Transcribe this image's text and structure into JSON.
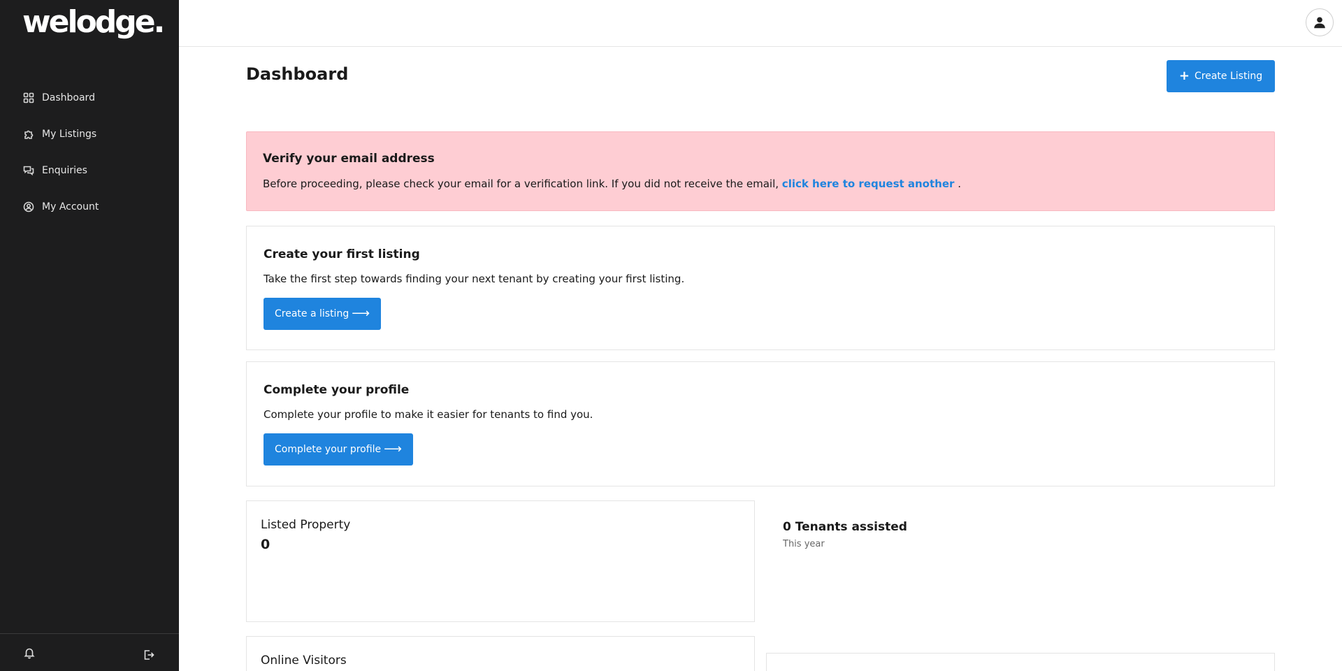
{
  "brand": {
    "logo_text": "welodge."
  },
  "sidebar": {
    "items": [
      {
        "label": "Dashboard",
        "icon": "grid-icon"
      },
      {
        "label": "My Listings",
        "icon": "puzzle-icon"
      },
      {
        "label": "Enquiries",
        "icon": "chat-icon"
      },
      {
        "label": "My Account",
        "icon": "user-circle-icon"
      }
    ],
    "bottom_icons": [
      "bell-icon",
      "logout-icon"
    ]
  },
  "header": {
    "avatar_icon": "user-icon"
  },
  "page": {
    "title": "Dashboard",
    "create_button": "Create Listing"
  },
  "alert": {
    "title": "Verify your email address",
    "text": "Before proceeding, please check your email for a verification link. If you did not receive the email,",
    "link": "click here to request another",
    "suffix": "."
  },
  "first_listing": {
    "title": "Create your first listing",
    "text": "Take the first step towards finding your next tenant by creating your first listing.",
    "button": "Create a listing"
  },
  "profile": {
    "title": "Complete your profile",
    "text": "Complete your profile to make it easier for tenants to find you.",
    "button": "Complete your profile"
  },
  "stats": {
    "listed_label": "Listed Property",
    "listed_value": "0",
    "tenants_label": "0 Tenants assisted",
    "tenants_sub": "This year",
    "visitors_label": "Online Visitors"
  },
  "colors": {
    "sidebar_bg": "#1d1d1e",
    "accent": "#1f84de",
    "alert_bg": "#fecdd3"
  }
}
